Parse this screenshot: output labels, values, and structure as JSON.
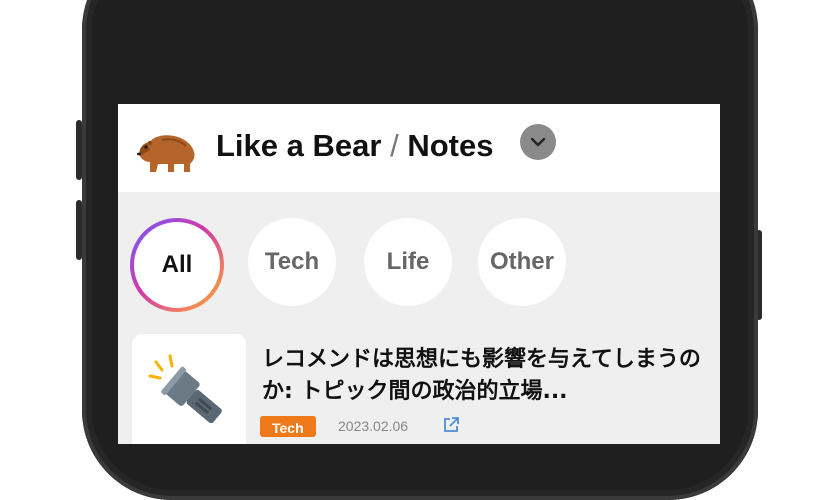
{
  "header": {
    "site_name": "Like a Bear",
    "separator": "/",
    "section": "Notes",
    "logo_icon": "bear-icon",
    "dropdown_icon": "chevron-down-icon"
  },
  "categories": [
    {
      "label": "All",
      "active": true
    },
    {
      "label": "Tech",
      "active": false
    },
    {
      "label": "Life",
      "active": false
    },
    {
      "label": "Other",
      "active": false
    }
  ],
  "posts": [
    {
      "title": "レコメンドは思想にも影響を与えてしまうのか: トピック間の政治的立場...",
      "tag": "Tech",
      "date": "2023.02.06",
      "thumb_icon": "flashlight-icon",
      "link_icon": "external-link-icon"
    }
  ],
  "colors": {
    "tag_tech": "#f07a1a",
    "active_ring_start": "#6f5cff",
    "active_ring_end": "#ffb12a",
    "phone_frame": "#1f1f1f"
  }
}
